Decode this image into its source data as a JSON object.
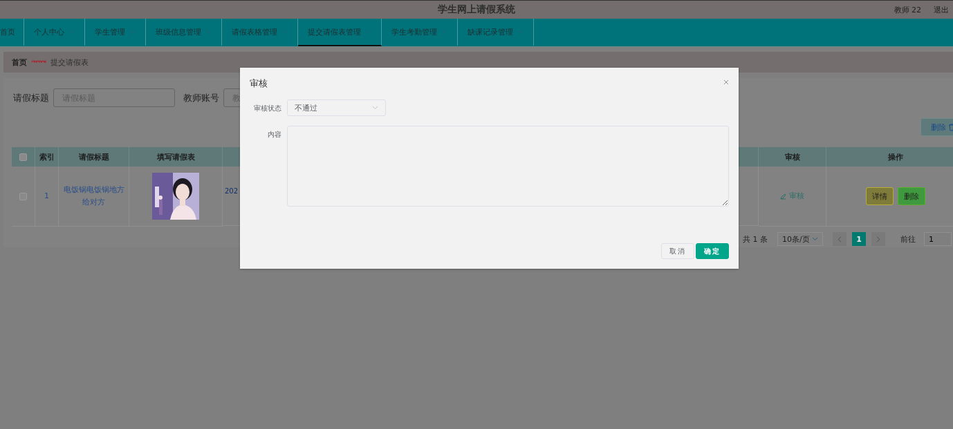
{
  "header": {
    "title": "学生网上请假系统",
    "user": "教师 22",
    "logout": "退出"
  },
  "nav": [
    {
      "label": "首页",
      "selected": false,
      "dropdown": false
    },
    {
      "label": "个人中心",
      "selected": false,
      "dropdown": true
    },
    {
      "label": "学生管理",
      "selected": false,
      "dropdown": true
    },
    {
      "label": "班级信息管理",
      "selected": false,
      "dropdown": true
    },
    {
      "label": "请假表格管理",
      "selected": false,
      "dropdown": true
    },
    {
      "label": "提交请假表管理",
      "selected": true,
      "dropdown": true
    },
    {
      "label": "学生考勤管理",
      "selected": false,
      "dropdown": true
    },
    {
      "label": "缺课记录管理",
      "selected": false,
      "dropdown": true
    }
  ],
  "breadcrumb": {
    "home": "首页",
    "current": "提交请假表"
  },
  "search": {
    "fields": [
      {
        "label": "请假标题",
        "placeholder": "请假标题"
      },
      {
        "label": "教师账号",
        "placeholder": "教"
      }
    ]
  },
  "delete_button": "删除",
  "table": {
    "select_all_checked": false,
    "columns": [
      "索引",
      "请假标题",
      "填写请假表",
      "审核",
      "操作"
    ],
    "rows": [
      {
        "checked": false,
        "index": "1",
        "title": "电饭锅电饭锅地方给对方",
        "submit_time": "202",
        "review": "审核",
        "actions": [
          "详情",
          "删除"
        ]
      }
    ]
  },
  "pagination": {
    "total": "共 1 条",
    "page_size": "10条/页",
    "pages": [
      {
        "label": "1",
        "selected": true
      }
    ],
    "goto_label": "前往",
    "goto_value": "1"
  },
  "dialog": {
    "title": "审核",
    "fields": [
      {
        "kind": "select",
        "label": "审核状态",
        "value": "不通过"
      },
      {
        "kind": "textarea",
        "label": "内容"
      }
    ],
    "buttons": [
      {
        "label": "取消",
        "primary": false
      },
      {
        "label": "确定",
        "primary": true
      }
    ]
  }
}
